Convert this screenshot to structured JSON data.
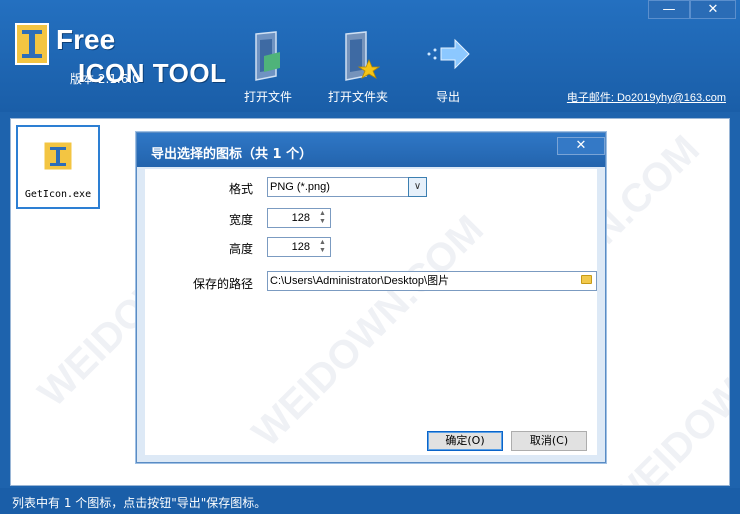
{
  "header": {
    "logo_free": "Free",
    "logo_tool": "ICON TOOL",
    "version": "版本 2.1.6.0",
    "email": "电子邮件: Do2019yhy@163.com",
    "window_controls": [
      "—",
      "✕"
    ]
  },
  "toolbar": [
    {
      "label": "打开文件",
      "icon": "open-file-icon"
    },
    {
      "label": "打开文件夹",
      "icon": "open-folder-icon"
    },
    {
      "label": "导出",
      "icon": "export-arrow-icon"
    }
  ],
  "file_list": {
    "items": [
      {
        "name": "GetIcon.exe",
        "icon": "app-icon"
      }
    ]
  },
  "dialog": {
    "title": "导出选择的图标（共 1 个）",
    "close": "✕",
    "format_label": "格式",
    "format_value": "PNG (*.png)",
    "width_label": "宽度",
    "width_value": "128",
    "height_label": "高度",
    "height_value": "128",
    "path_label": "保存的路径",
    "path_value": "C:\\Users\\Administrator\\Desktop\\图片",
    "ok_label": "确定(O)",
    "cancel_label": "取消(C)"
  },
  "status": "列表中有 1 个图标，点击按钮\"导出\"保存图标。",
  "colors": {
    "accent": "#1e63ad",
    "selection": "#2d7fd3"
  }
}
